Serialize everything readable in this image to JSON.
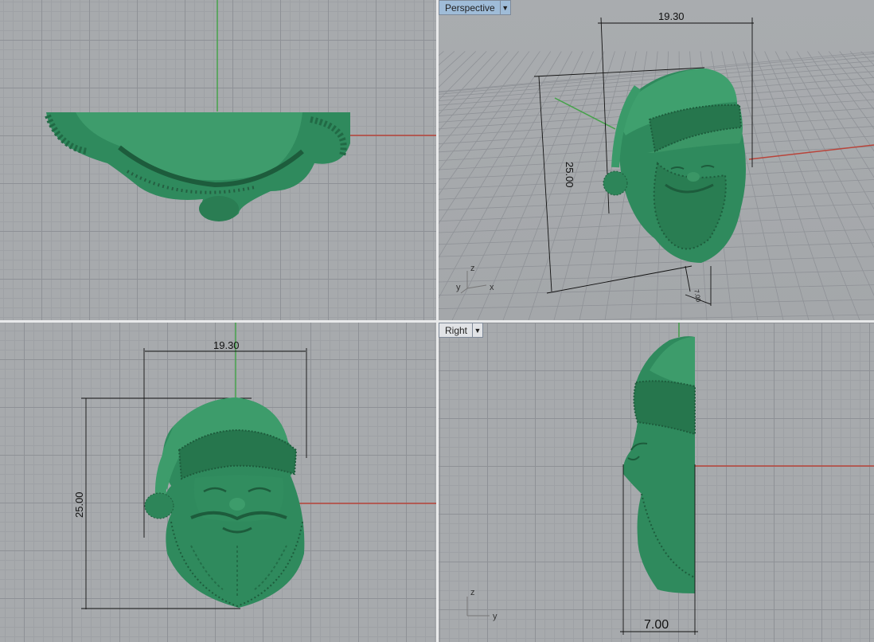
{
  "viewports": {
    "top": {
      "label": ""
    },
    "perspective": {
      "label": "Perspective",
      "dims": {
        "width": "19.30",
        "height": "25.00",
        "depth": "7.00"
      },
      "axes": {
        "x": "x",
        "y": "y",
        "z": "z"
      }
    },
    "front": {
      "label": "",
      "dims": {
        "width": "19.30",
        "height": "25.00"
      }
    },
    "right": {
      "label": "Right",
      "dims": {
        "depth": "7.00"
      },
      "axes": {
        "y": "y",
        "z": "z"
      }
    }
  },
  "colors": {
    "model": "#2f8a5d",
    "model_dark": "#1d5c3c",
    "model_light": "#58b385",
    "x_axis": "#b9443a",
    "y_axis": "#46a24b",
    "grid_bg": "#a7aaad"
  },
  "icons": [
    "dropdown-arrow-icon",
    "axis-gizmo-icon"
  ]
}
